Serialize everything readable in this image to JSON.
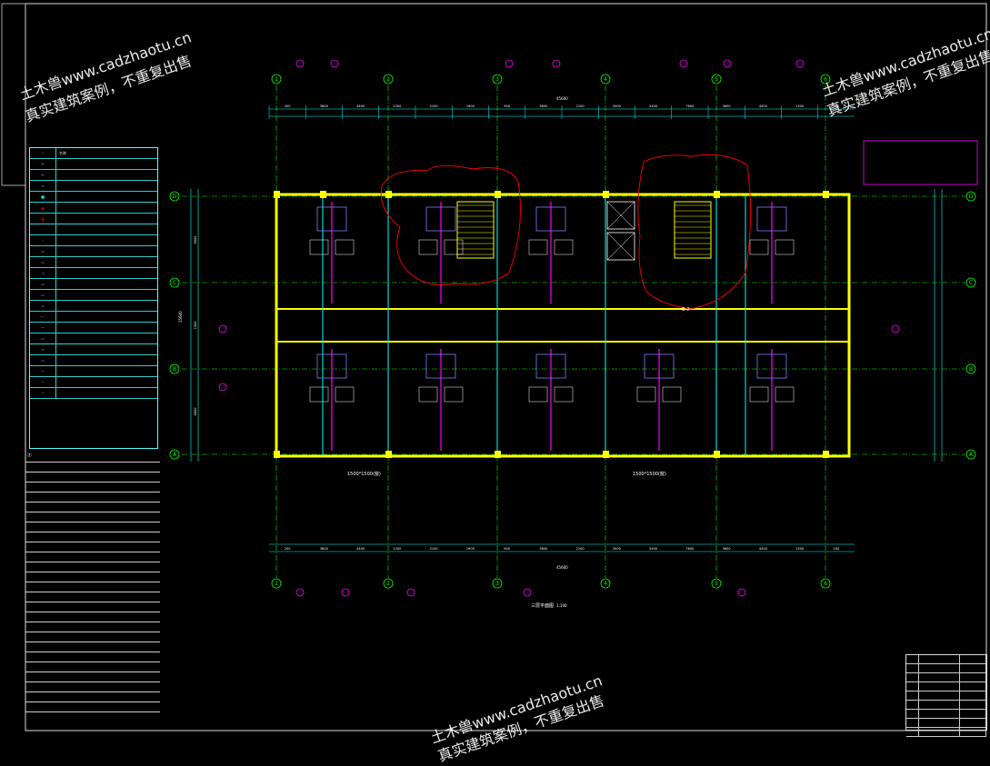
{
  "colors": {
    "background": "#000000",
    "wall": "#ffff00",
    "dimension": "#00ffff",
    "grid_line": "#00ff00",
    "annotation": "#ff00ff",
    "revision_cloud": "#ff0000",
    "room_furniture": "#7f7fff"
  },
  "watermark": {
    "line1": "土木兽www.cadzhaotu.cn",
    "line2": "真实建筑案例，不重复出售"
  },
  "grid_columns": [
    "1",
    "2",
    "3",
    "4",
    "5",
    "6"
  ],
  "grid_rows": [
    "D",
    "C",
    "B",
    "A"
  ],
  "dimensions": {
    "overall": "45600",
    "top_chain": [
      "200",
      "3600",
      "4400",
      "1300",
      "2100",
      "1900",
      "900",
      "3600",
      "2100",
      "3000",
      "5400",
      "7600",
      "3600",
      "4400",
      "1300",
      "200"
    ],
    "left_chain": [
      "6600",
      "2300",
      "6600"
    ],
    "left_total": "15600"
  },
  "annotations": {
    "plan_title": "三层平面图",
    "plan_scale": "1:100",
    "window_note_left": "1500*1500(窗)",
    "window_note_right": "1500*1500(窗)",
    "section_tag": "B-2"
  },
  "legend_rows": [
    {
      "sym": "—",
      "text": "名称"
    },
    {
      "sym": "═",
      "text": ""
    },
    {
      "sym": "═",
      "text": ""
    },
    {
      "sym": "▭",
      "text": ""
    },
    {
      "sym": "■",
      "text": ""
    },
    {
      "sym": "▲",
      "text": ""
    },
    {
      "sym": "▲",
      "text": ""
    },
    {
      "sym": "·",
      "text": ""
    },
    {
      "sym": "·",
      "text": ""
    },
    {
      "sym": "▭",
      "text": ""
    },
    {
      "sym": "▭",
      "text": ""
    },
    {
      "sym": "◁",
      "text": ""
    },
    {
      "sym": "▭",
      "text": ""
    },
    {
      "sym": "▭",
      "text": ""
    },
    {
      "sym": "▭",
      "text": ""
    },
    {
      "sym": "—",
      "text": ""
    },
    {
      "sym": "—",
      "text": ""
    },
    {
      "sym": "▭",
      "text": ""
    },
    {
      "sym": "▭",
      "text": ""
    },
    {
      "sym": "▭",
      "text": ""
    },
    {
      "sym": "—",
      "text": ""
    },
    {
      "sym": "—",
      "text": ""
    },
    {
      "sym": "—",
      "text": ""
    }
  ],
  "notes_rows": [
    "注:",
    "",
    "",
    "",
    "",
    "",
    "",
    "",
    "",
    "",
    "",
    "",
    "",
    "",
    "",
    "",
    "",
    "",
    "",
    "",
    "",
    "",
    "",
    "",
    "",
    ""
  ],
  "titleblock_rows": [
    [
      "",
      "",
      ""
    ],
    [
      "",
      "",
      ""
    ],
    [
      "",
      "",
      ""
    ],
    [
      "",
      "",
      ""
    ],
    [
      "",
      "",
      ""
    ],
    [
      "",
      "",
      ""
    ],
    [
      "",
      "",
      ""
    ],
    [
      "",
      "",
      ""
    ],
    [
      "",
      "",
      ""
    ]
  ]
}
